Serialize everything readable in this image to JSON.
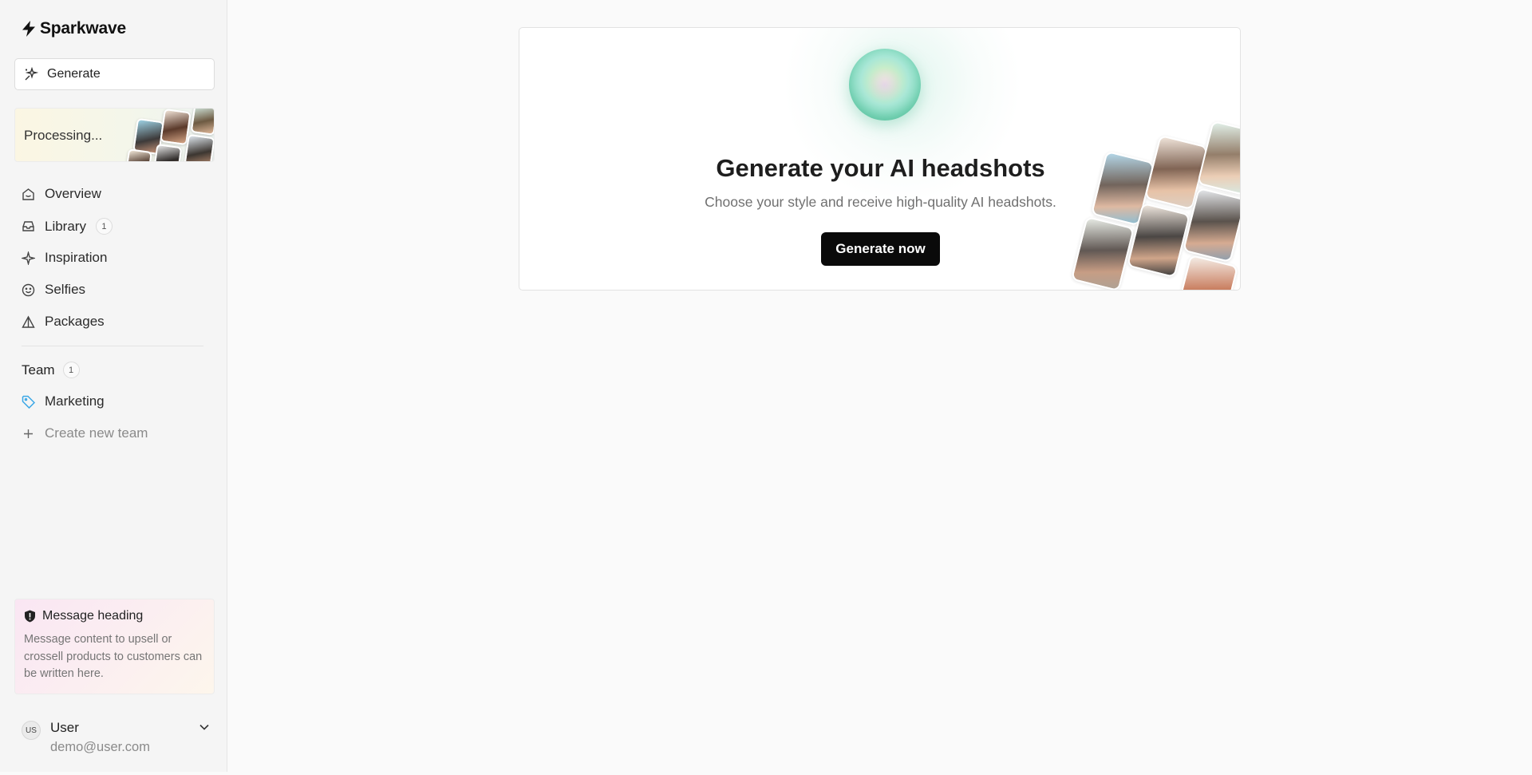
{
  "brand": {
    "name": "Sparkwave"
  },
  "sidebar": {
    "generate_label": "Generate",
    "processing_label": "Processing...",
    "nav": [
      {
        "label": "Overview",
        "icon": "home-icon"
      },
      {
        "label": "Library",
        "icon": "inbox-icon",
        "badge": "1"
      },
      {
        "label": "Inspiration",
        "icon": "sparkle-icon"
      },
      {
        "label": "Selfies",
        "icon": "smile-icon"
      },
      {
        "label": "Packages",
        "icon": "triangle-icon"
      }
    ],
    "team": {
      "heading": "Team",
      "badge": "1",
      "items": [
        {
          "label": "Marketing",
          "icon": "tag-icon",
          "color": "#3ba7e6"
        }
      ],
      "create_label": "Create new team"
    },
    "message": {
      "heading": "Message heading",
      "body": "Message content to upsell or crossell products to customers can be written here."
    },
    "user": {
      "initials": "US",
      "name": "User",
      "email": "demo@user.com"
    }
  },
  "main": {
    "title": "Generate your AI headshots",
    "subtitle": "Choose your style and receive high-quality AI headshots.",
    "cta_label": "Generate now"
  }
}
